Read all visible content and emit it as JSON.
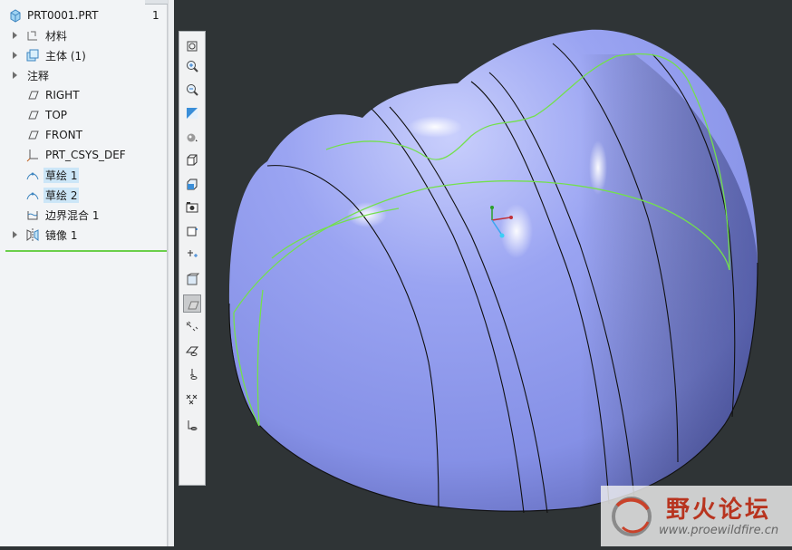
{
  "model_tree": {
    "root": {
      "label": "PRT0001.PRT",
      "col": "1"
    },
    "items": [
      {
        "label": "材料",
        "expandable": true,
        "icon": "material-icon"
      },
      {
        "label": "主体 (1)",
        "expandable": true,
        "icon": "body-icon"
      },
      {
        "label": "注释",
        "expandable": true,
        "icon": "annotation-icon"
      },
      {
        "label": "RIGHT",
        "expandable": false,
        "icon": "datum-plane-icon"
      },
      {
        "label": "TOP",
        "expandable": false,
        "icon": "datum-plane-icon"
      },
      {
        "label": "FRONT",
        "expandable": false,
        "icon": "datum-plane-icon"
      },
      {
        "label": "PRT_CSYS_DEF",
        "expandable": false,
        "icon": "csys-icon"
      },
      {
        "label": "草绘 1",
        "expandable": false,
        "icon": "sketch-icon",
        "selected": true
      },
      {
        "label": "草绘 2",
        "expandable": false,
        "icon": "sketch-icon",
        "selected": true
      },
      {
        "label": "边界混合 1",
        "expandable": false,
        "icon": "boundary-blend-icon"
      },
      {
        "label": "镜像 1",
        "expandable": true,
        "icon": "mirror-icon"
      }
    ]
  },
  "toolbar": {
    "tools": [
      "refit-icon",
      "zoom-in-icon",
      "zoom-out-icon",
      "repaint-icon",
      "display-style-icon",
      "saved-orientations-icon",
      "view-manager-icon",
      "perspective-view-icon",
      "section-icon",
      "annotation-display-icon",
      "spin-center-icon",
      "plane-display-icon",
      "axis-display-icon",
      "point-display-icon",
      "csys-display-icon",
      "annotation-filter-icon",
      "appearance-icon"
    ]
  },
  "colors": {
    "model": "#8f9bef",
    "edge": "#101010",
    "sketch": "#73e04d",
    "selection": "#cce6f7"
  },
  "watermark": {
    "title": "野火论坛",
    "url": "www.proewildfire.cn"
  }
}
